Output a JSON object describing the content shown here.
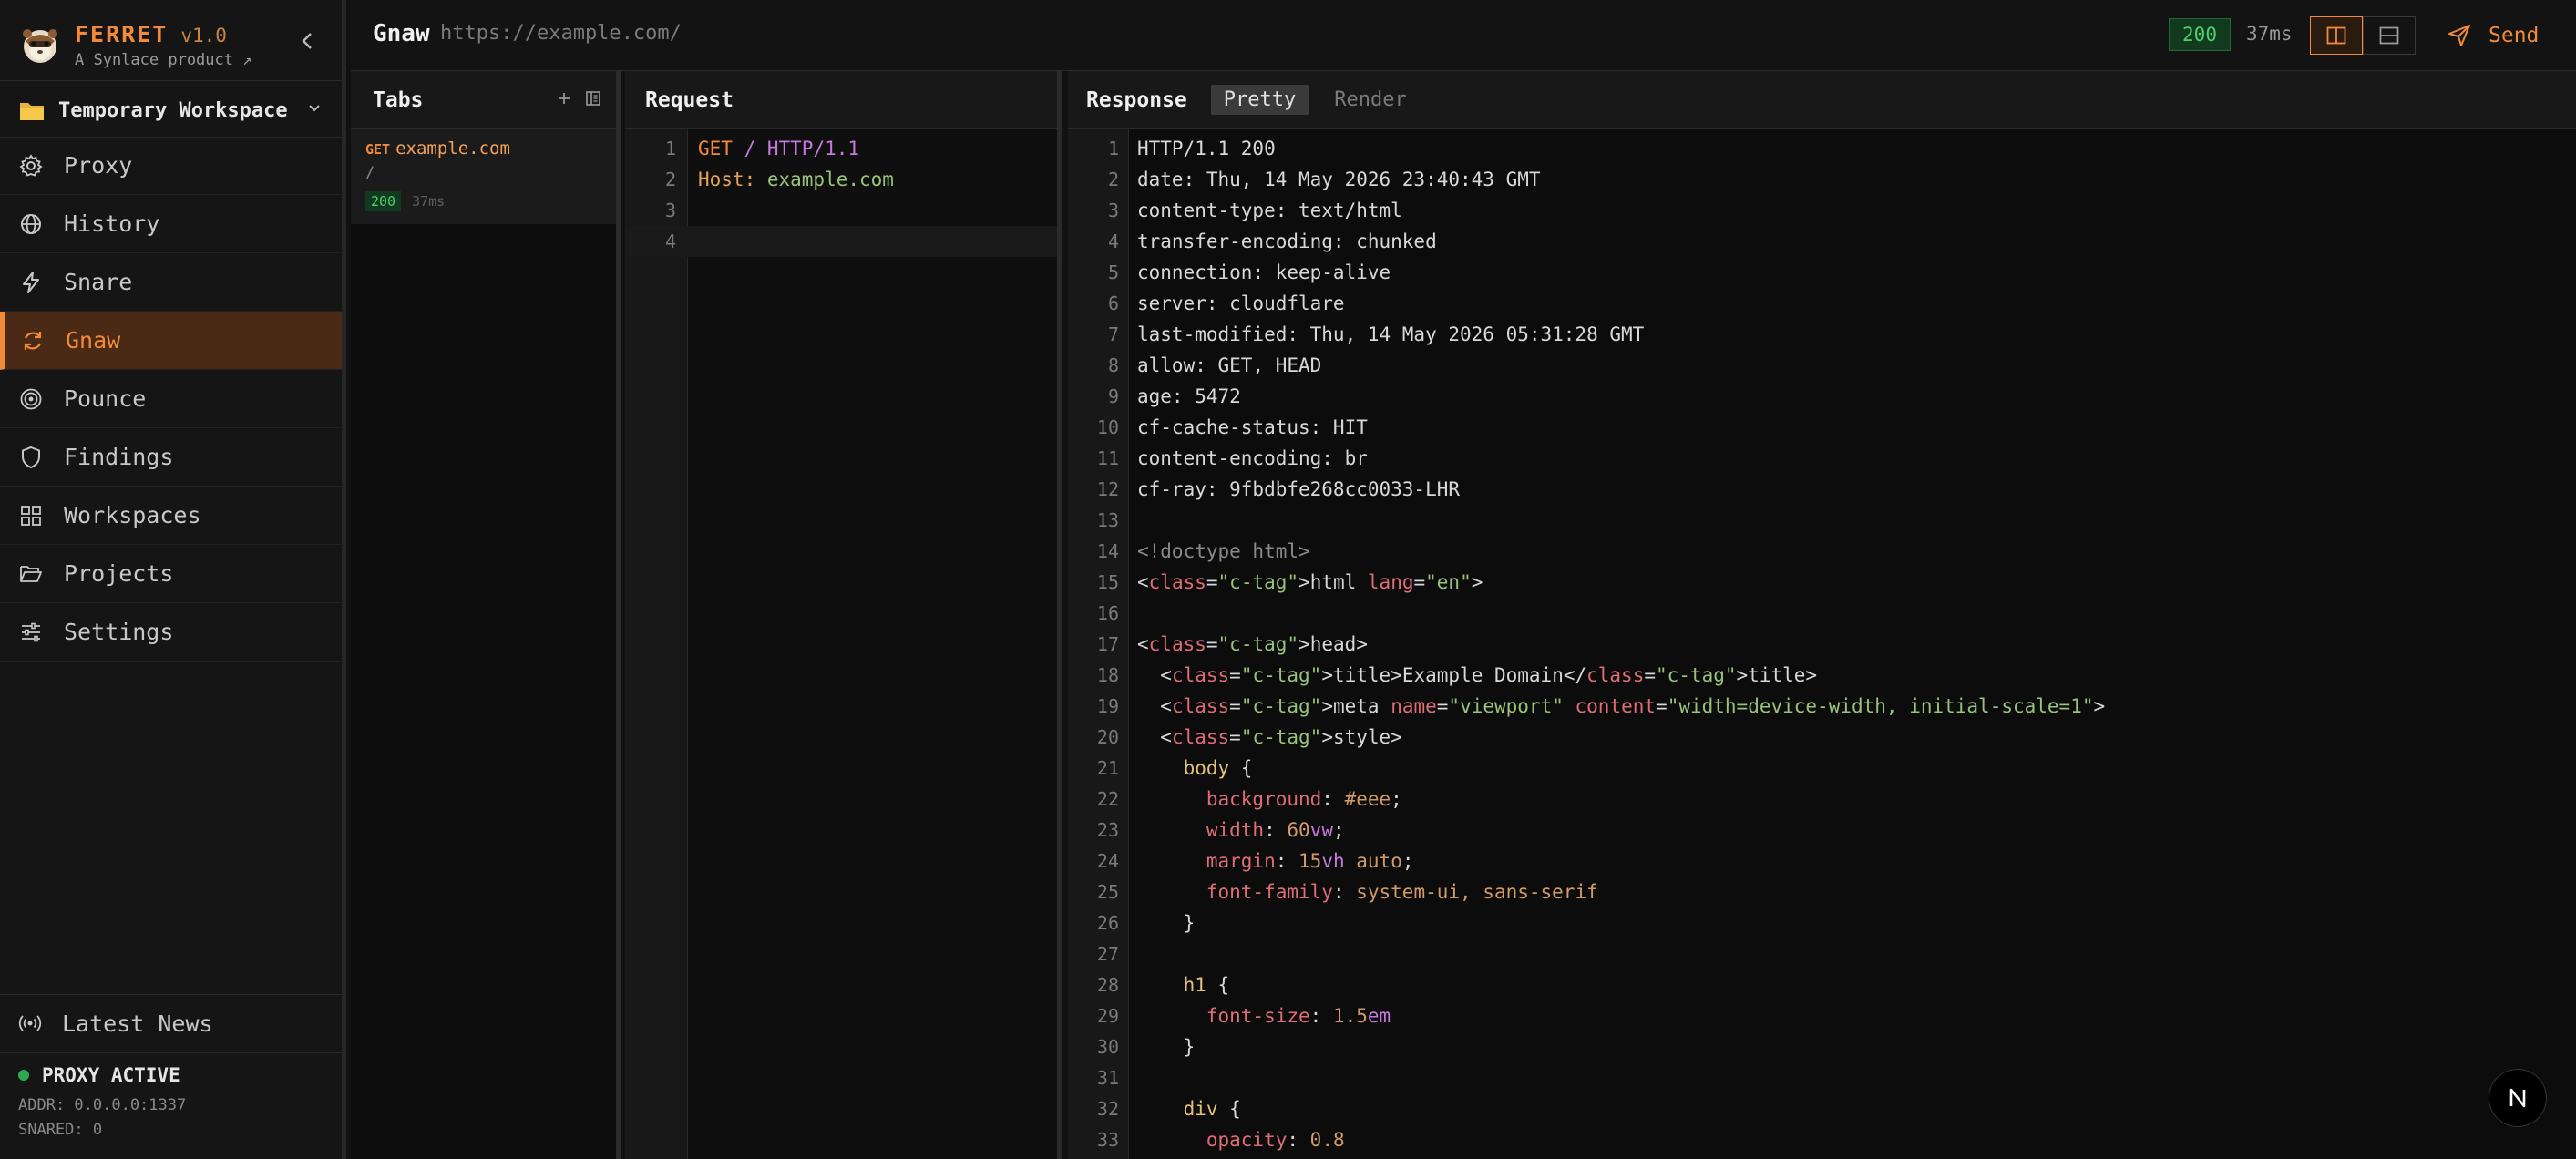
{
  "brand": {
    "name": "FERRET",
    "version": "v1.0",
    "subtitle": "A Synlace product ↗"
  },
  "workspace": {
    "label": "Temporary Workspace",
    "icon": "folder-icon"
  },
  "nav": [
    {
      "label": "Proxy",
      "icon": "gear-icon",
      "active": false
    },
    {
      "label": "History",
      "icon": "globe-icon",
      "active": false
    },
    {
      "label": "Snare",
      "icon": "bolt-icon",
      "active": false
    },
    {
      "label": "Gnaw",
      "icon": "refresh-icon",
      "active": true
    },
    {
      "label": "Pounce",
      "icon": "target-icon",
      "active": false
    },
    {
      "label": "Findings",
      "icon": "shield-icon",
      "active": false
    },
    {
      "label": "Workspaces",
      "icon": "grid-icon",
      "active": false
    },
    {
      "label": "Projects",
      "icon": "folder-open-icon",
      "active": false
    },
    {
      "label": "Settings",
      "icon": "sliders-icon",
      "active": false
    }
  ],
  "news": {
    "label": "Latest News",
    "icon": "broadcast-icon"
  },
  "proxy": {
    "status": "PROXY ACTIVE",
    "addr": "ADDR: 0.0.0.0:1337",
    "snared": "SNARED: 0",
    "status_color": "#2ea84f"
  },
  "topbar": {
    "title": "Gnaw",
    "url": "https://example.com/",
    "status_code": "200",
    "time": "37ms",
    "send_label": "Send"
  },
  "colors": {
    "accent": "#f28a3c",
    "success": "#4fd06e"
  },
  "tabs_panel": {
    "title": "Tabs",
    "items": [
      {
        "method": "GET",
        "host": "example.com",
        "path": "/",
        "status": "200",
        "time": "37ms"
      }
    ]
  },
  "request": {
    "title": "Request",
    "line_numbers": [
      "1",
      "2",
      "3",
      "4"
    ],
    "lines": [
      {
        "method": "GET",
        "path": "/ HTTP/1.1"
      },
      {
        "key": "Host:",
        "value": " example.com"
      }
    ]
  },
  "response": {
    "title": "Response",
    "tabs": [
      "Pretty",
      "Render"
    ],
    "active_tab": "Pretty",
    "line_numbers": [
      "1",
      "2",
      "3",
      "4",
      "5",
      "6",
      "7",
      "8",
      "9",
      "10",
      "11",
      "12",
      "13",
      "14",
      "15",
      "16",
      "17",
      "18",
      "19",
      "20",
      "21",
      "22",
      "23",
      "24",
      "25",
      "26",
      "27",
      "28",
      "29",
      "30",
      "31",
      "32",
      "33"
    ],
    "lines": [
      "HTTP/1.1 200",
      "date: Thu, 14 May 2026 23:40:43 GMT",
      "content-type: text/html",
      "transfer-encoding: chunked",
      "connection: keep-alive",
      "server: cloudflare",
      "last-modified: Thu, 14 May 2026 05:31:28 GMT",
      "allow: GET, HEAD",
      "age: 5472",
      "cf-cache-status: HIT",
      "content-encoding: br",
      "cf-ray: 9fbdbfe268cc0033-LHR",
      "",
      "<!doctype html>",
      "<html lang=\"en\">",
      "",
      "<head>",
      "  <title>Example Domain</title>",
      "  <meta name=\"viewport\" content=\"width=device-width, initial-scale=1\">",
      "  <style>",
      "    body {",
      "      background: #eee;",
      "      width: 60vw;",
      "      margin: 15vh auto;",
      "      font-family: system-ui, sans-serif",
      "    }",
      "",
      "    h1 {",
      "      font-size: 1.5em",
      "    }",
      "",
      "    div {",
      "      opacity: 0.8"
    ]
  },
  "floating_button": {
    "label": "N"
  }
}
